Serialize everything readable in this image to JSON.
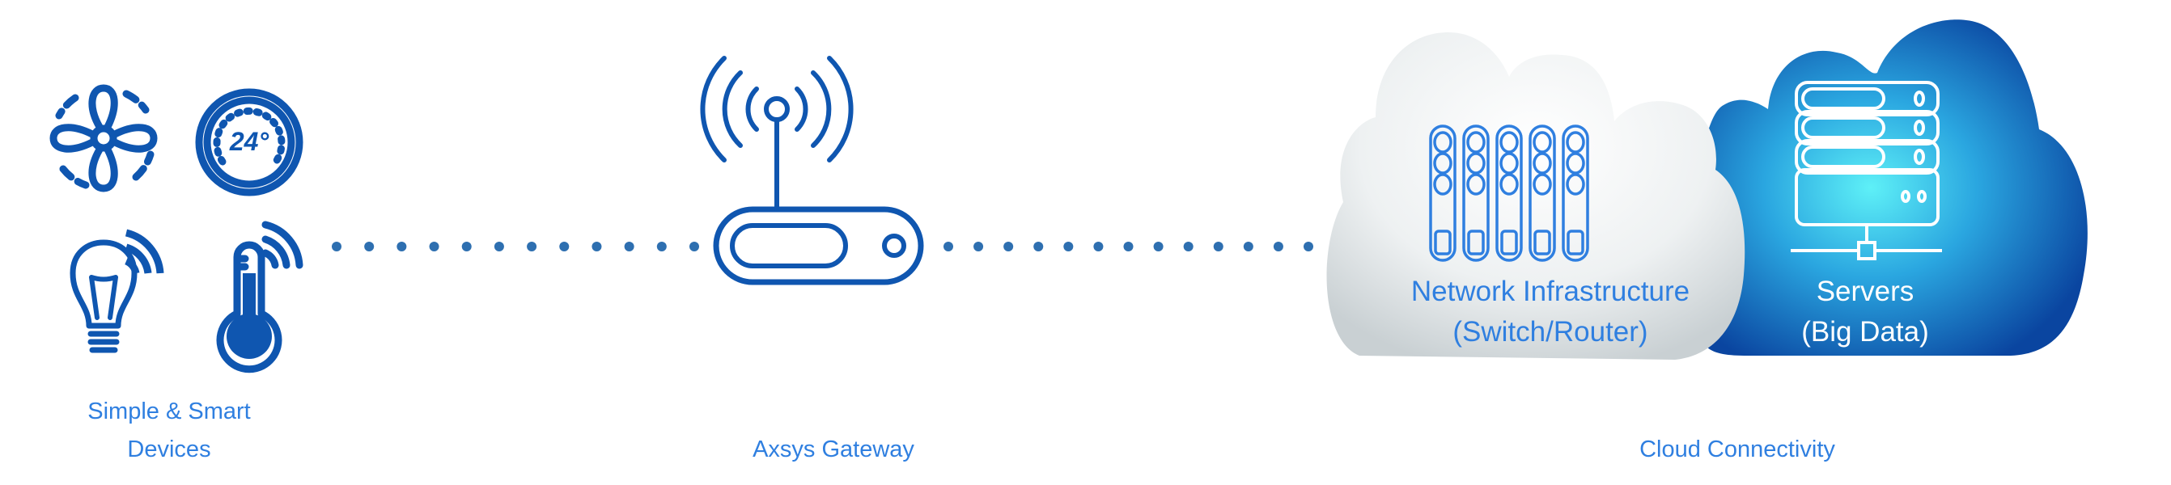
{
  "colors": {
    "icon": "#0f56b0",
    "label": "#2f7fe0",
    "dots": "#2e6fb0",
    "cloud_grey": "#dfe4e6",
    "cloud_blue": "#0b4fa8",
    "cloud_glow": "#52e8f5"
  },
  "devices": {
    "label_line1": "Simple & Smart",
    "label_line2": "Devices",
    "icons": [
      "fan-icon",
      "thermostat-icon",
      "smart-bulb-icon",
      "smart-thermometer-icon"
    ],
    "thermostat_reading": "24°"
  },
  "gateway": {
    "label": "Axsys Gateway",
    "icon": "wireless-router-icon"
  },
  "cloud": {
    "label": "Cloud Connectivity",
    "network": {
      "line1": "Network Infrastructure",
      "line2": "(Switch/Router)",
      "icon": "switch-rack-icon"
    },
    "servers": {
      "line1": "Servers",
      "line2": "(Big Data)",
      "icon": "server-stack-icon"
    }
  }
}
